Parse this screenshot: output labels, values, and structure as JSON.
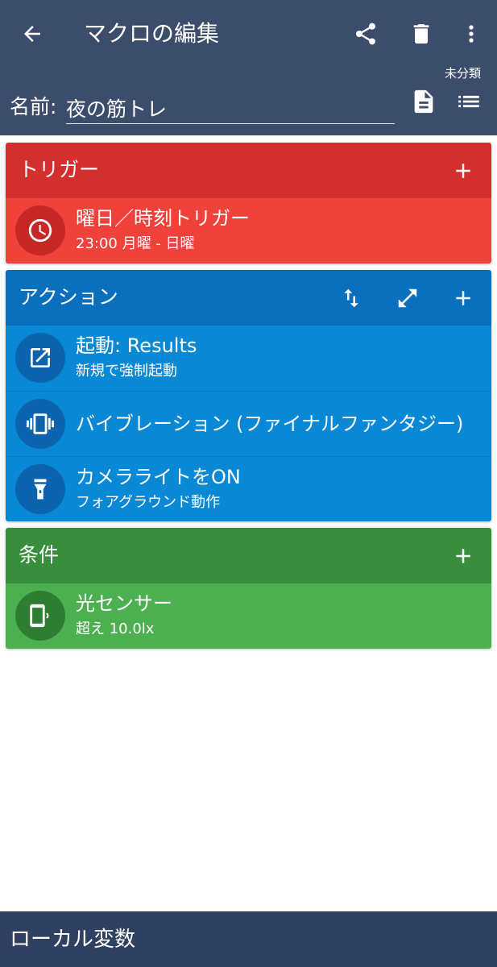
{
  "appbar": {
    "title": "マクロの編集",
    "category": "未分類",
    "name_label": "名前:",
    "name_value": "夜の筋トレ",
    "icons": [
      "back-arrow-icon",
      "share-icon",
      "trash-icon",
      "more-vert-icon",
      "document-icon",
      "list-icon"
    ]
  },
  "trigger": {
    "header": "トリガー",
    "color": "#d32f2f",
    "items": [
      {
        "icon": "clock-icon",
        "main": "曜日／時刻トリガー",
        "sub": "23:00 月曜 - 日曜"
      }
    ]
  },
  "action": {
    "header": "アクション",
    "color": "#0a6fbd",
    "items": [
      {
        "icon": "open-external-icon",
        "main": "起動: Results",
        "sub": "新規で強制起動"
      },
      {
        "icon": "vibration-icon",
        "main": "バイブレーション (ファイナルファンタジー)",
        "sub": ""
      },
      {
        "icon": "flashlight-icon",
        "main": "カメラライトをON",
        "sub": "フォアグラウンド動作"
      }
    ]
  },
  "condition": {
    "header": "条件",
    "color": "#388e3c",
    "items": [
      {
        "icon": "light-sensor-icon",
        "main": "光センサー",
        "sub": "超え 10.0lx"
      }
    ]
  },
  "bottombar": {
    "label": "ローカル変数"
  }
}
